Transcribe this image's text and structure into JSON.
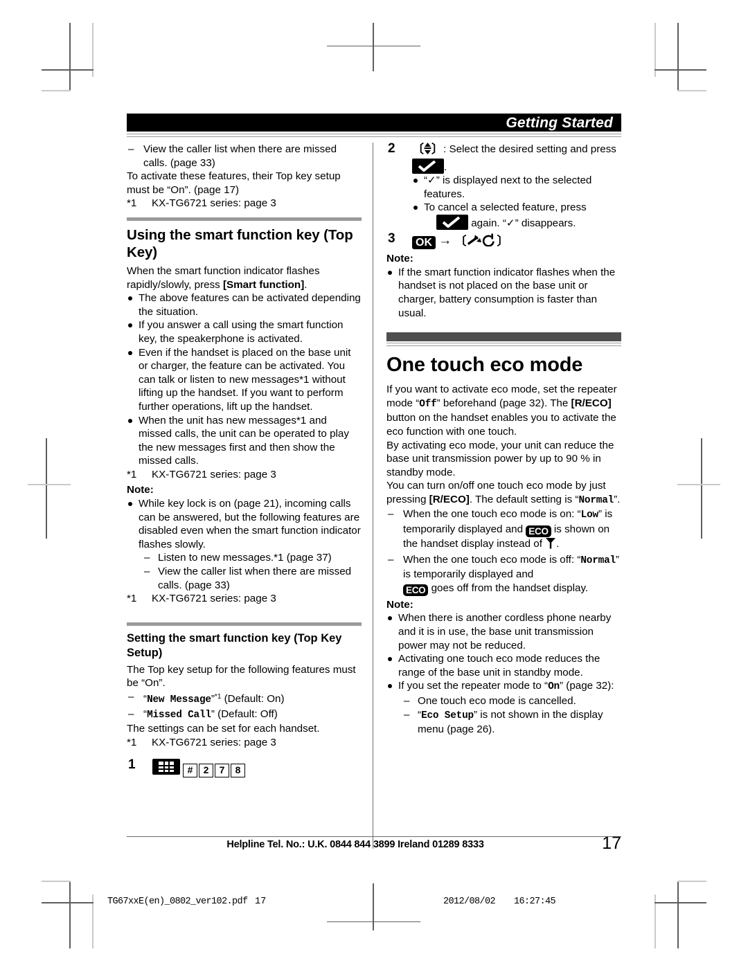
{
  "header": {
    "section_title": "Getting Started"
  },
  "left_column": {
    "continued_dash_items": [
      "View the caller list when there are missed calls. (page 33)"
    ],
    "continued_para": "To activate these features, their Top key setup must be “On”. (page 17)",
    "footnote_mark": "*1",
    "footnote_text": "KX-TG6721 series: page 3",
    "section1": {
      "heading": "Using the smart function key (Top Key)",
      "intro_before": "When the smart function indicator flashes rapidly/slowly, press ",
      "intro_key": "[Smart function]",
      "intro_after": ".",
      "bullets": [
        "The above features can be activated depending the situation.",
        "If you answer a call using the smart function key, the speakerphone is activated.",
        "Even if the handset is placed on the base unit or charger, the feature can be activated. You can talk or listen to new messages*1 without lifting up the handset. If you want to perform further operations, lift up the handset.",
        "When the unit has new messages*1 and missed calls, the unit can be operated to play the new messages first and then show the missed calls."
      ],
      "footnote_mark": "*1",
      "footnote_text": "KX-TG6721 series: page 3",
      "note_label": "Note:",
      "note_bullet": "While key lock is on (page 21), incoming calls can be answered, but the following features are disabled even when the smart function indicator flashes slowly.",
      "note_dashes": [
        "Listen to new messages.*1 (page 37)",
        "View the caller list when there are missed calls. (page 33)"
      ],
      "note_footnote_mark": "*1",
      "note_footnote_text": "KX-TG6721 series: page 3"
    },
    "section2": {
      "heading": "Setting the smart function key (Top Key Setup)",
      "intro": "The Top key setup for the following features must be “On”.",
      "dash_items": [
        {
          "quoted": "New Message",
          "sup": "*1",
          "rest": " (Default: On)"
        },
        {
          "quoted": "Missed Call",
          "sup": "",
          "rest": " (Default: Off)"
        }
      ],
      "after": "The settings can be set for each handset.",
      "footnote_mark": "*1",
      "footnote_text": "KX-TG6721 series: page 3",
      "step1": {
        "number": "1",
        "keys": [
          "#",
          "2",
          "7",
          "8"
        ],
        "menu_icon": "menu-grid-icon"
      }
    }
  },
  "right_column": {
    "step2": {
      "number": "2",
      "text_before": ": Select the desired setting and press",
      "text_after": ".",
      "navkey_icon": "updown-navigation-key-icon",
      "check_icon": "checkmark-softkey-icon",
      "bullets": [
        "“✓” is displayed next to the selected features.",
        "To cancel a selected feature, press"
      ],
      "bullet2_tail": "again. “✓” disappears."
    },
    "step3": {
      "number": "3",
      "ok_label": "OK",
      "arrow": "→",
      "offhook_icon": "power-offhook-key-icon"
    },
    "note1": {
      "label": "Note:",
      "bullets": [
        "If the smart function indicator flashes when the handset is not placed on the base unit or charger, battery consumption is faster than usual."
      ]
    },
    "section": {
      "heading": "One touch eco mode",
      "paragraphs": [
        {
          "parts": [
            {
              "t": "If you want to activate eco mode, set the repeater mode “"
            },
            {
              "t": "Off",
              "style": "mono"
            },
            {
              "t": "” beforehand (page 32). The "
            },
            {
              "t": "[R/ECO]",
              "style": "bold"
            },
            {
              "t": " button on the handset enables you to activate the eco function with one touch."
            }
          ]
        },
        {
          "parts": [
            {
              "t": "By activating eco mode, your unit can reduce the base unit transmission power by up to 90 % in standby mode."
            }
          ]
        },
        {
          "parts": [
            {
              "t": "You can turn on/off one touch eco mode by just pressing "
            },
            {
              "t": "[R/ECO]",
              "style": "bold"
            },
            {
              "t": ". The default setting is “"
            },
            {
              "t": "Normal",
              "style": "mono"
            },
            {
              "t": "”."
            }
          ]
        }
      ],
      "dash_item_1_pre": "When the one touch eco mode is on: “",
      "dash_item_1_mono": "Low",
      "dash_item_1_mid": "” is temporarily displayed and",
      "dash_item_1_mid2": "is shown on the handset display instead of",
      "dash_item_1_end": ".",
      "dash_item_2_pre": "When the one touch eco mode is off: “",
      "dash_item_2_mono": "Normal",
      "dash_item_2_mid": "” is temporarily displayed and",
      "dash_item_2_end": "goes off from the handset display.",
      "eco_badge": "ECO",
      "antenna_icon": "antenna-signal-icon"
    },
    "note2": {
      "label": "Note:",
      "bullets": [
        "When there is another cordless phone nearby and it is in use, the base unit transmission power may not be reduced.",
        "Activating one touch eco mode reduces the range of the base unit in standby mode."
      ],
      "bullet3_pre": "If you set the repeater mode to “",
      "bullet3_mono": "On",
      "bullet3_post": "” (page 32):",
      "sub_dashes": [
        {
          "pre": "One touch eco mode is cancelled.",
          "mono": "",
          "post": ""
        },
        {
          "pre": "“",
          "mono": "Eco Setup",
          "post": "” is not shown in the display menu (page 26)."
        }
      ]
    }
  },
  "footer": {
    "helpline": "Helpline Tel. No.: U.K. 0844 844 3899 Ireland 01289 8333",
    "page_number": "17"
  },
  "print_meta": {
    "filename": "TG67xxE(en)_0802_ver102.pdf",
    "page": "17",
    "date": "2012/08/02",
    "time": "16:27:45"
  }
}
